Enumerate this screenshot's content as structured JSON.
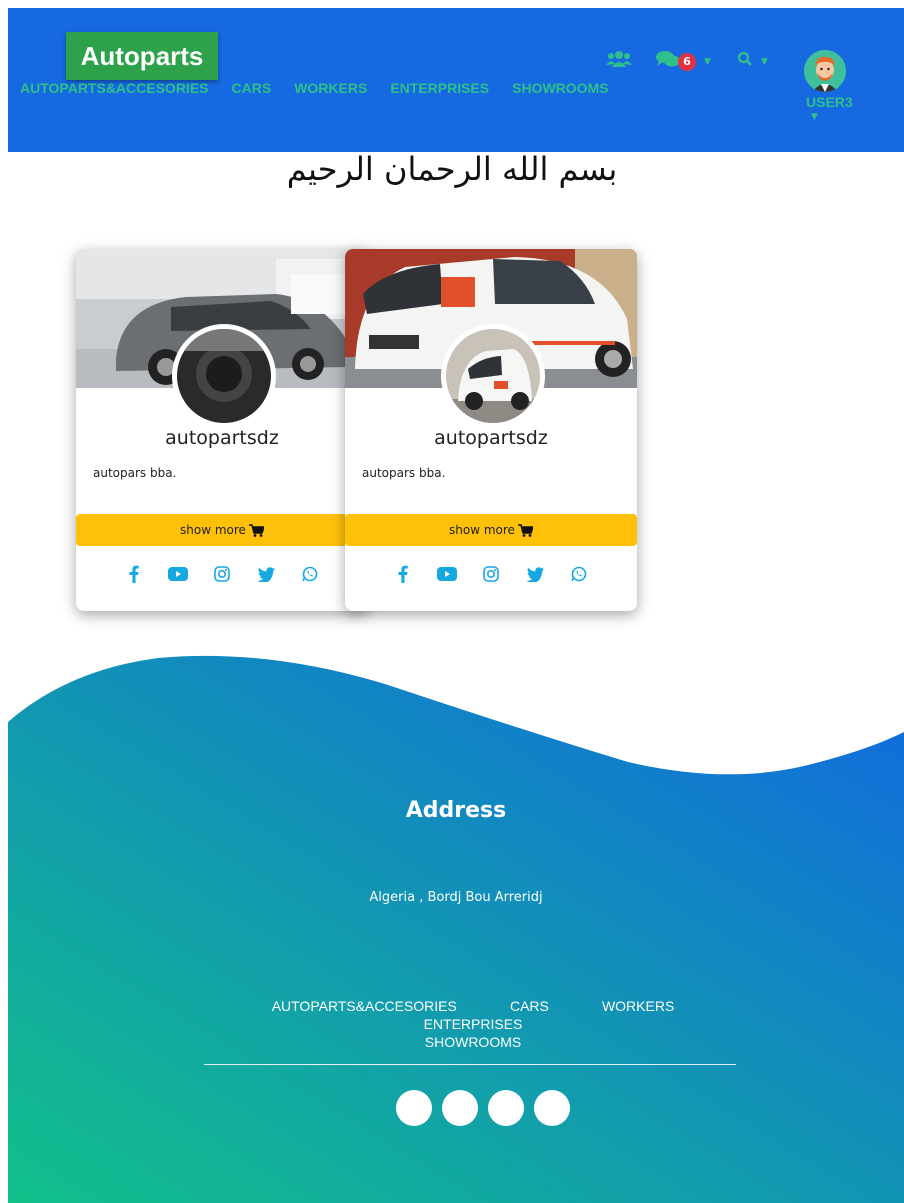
{
  "brand": "Autoparts",
  "nav": {
    "links": [
      "AUTOPARTS&ACCESORIES",
      "CARS",
      "WORKERS",
      "ENTERPRISES",
      "SHOWROOMS"
    ],
    "messages_count": "6",
    "user": "USER3",
    "icons": [
      "users-icon",
      "comments-icon",
      "search-icon"
    ]
  },
  "heading": "بسم الله الرحمان الرحيم",
  "cards": [
    {
      "name": "autopartsdz",
      "description": "autopars bba.",
      "button": "show more"
    },
    {
      "name": "autopartsdz",
      "description": "autopars bba.",
      "button": "show more"
    }
  ],
  "social_icons": [
    "facebook-icon",
    "youtube-icon",
    "instagram-icon",
    "twitter-icon",
    "whatsapp-icon"
  ],
  "footer": {
    "address_title": "Address",
    "address": "Algeria , Bordj Bou Arreridj",
    "links": [
      "AUTOPARTS&ACCESORIES",
      "CARS",
      "WORKERS",
      "ENTERPRISES",
      "SHOWROOMS"
    ]
  },
  "colors": {
    "navbar": "#1669e0",
    "brand_bg": "#2ea24a",
    "nav_link": "#2ec08a",
    "button": "#ffc107",
    "social_icon": "#16a8e0",
    "footer_gradient_start": "#12c08a",
    "footer_gradient_end": "#1168e0"
  }
}
